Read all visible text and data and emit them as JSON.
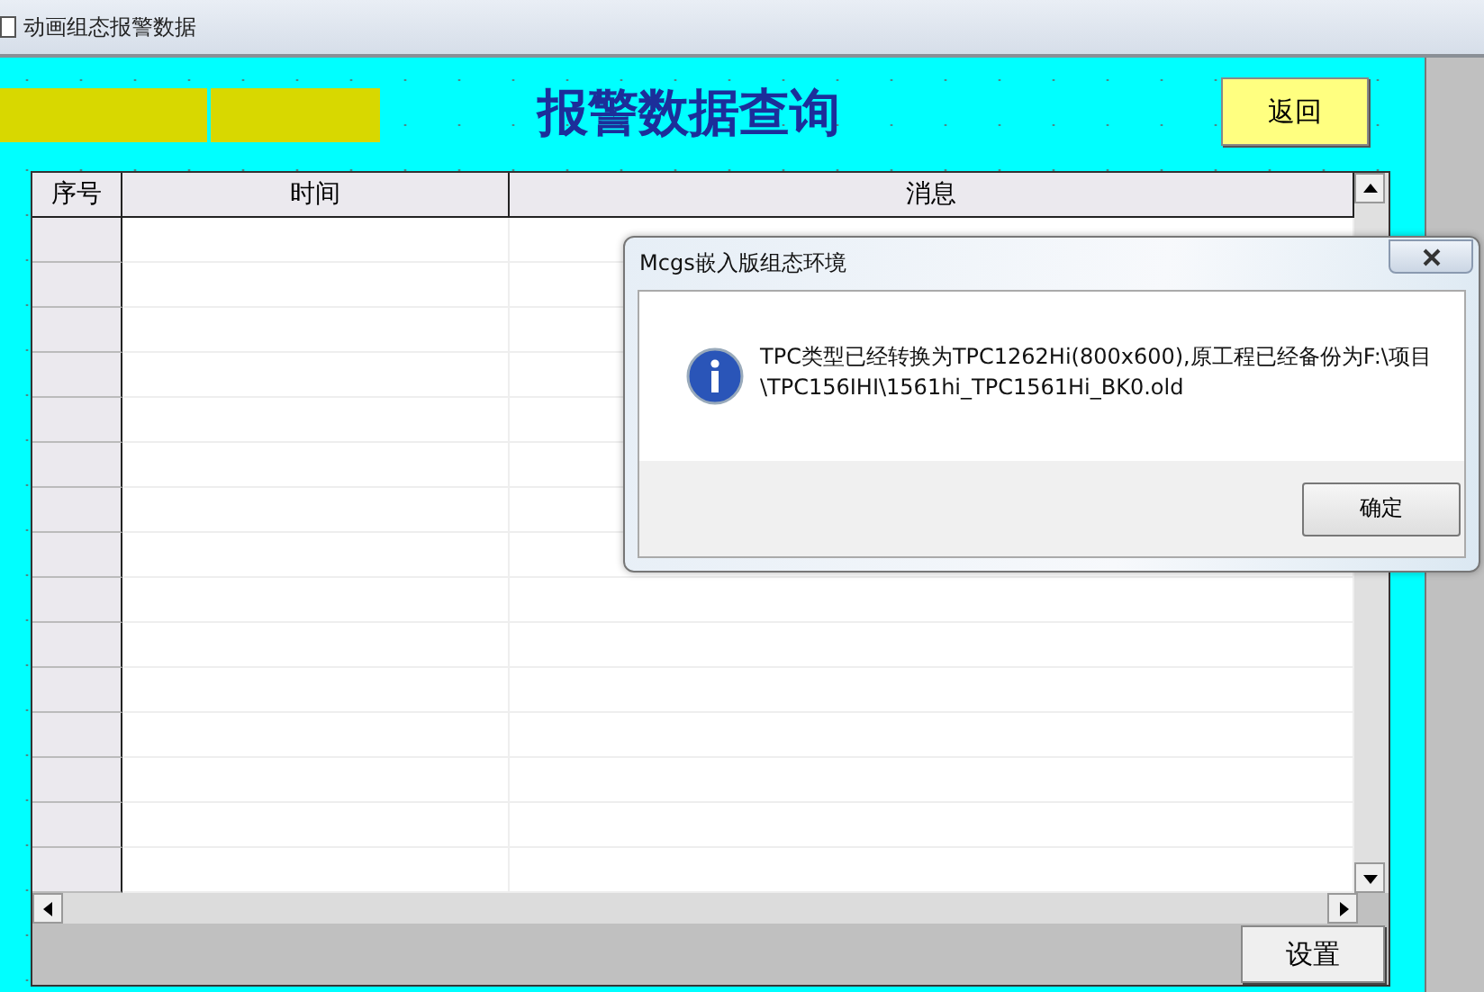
{
  "window": {
    "title": "动画组态报警数据"
  },
  "header": {
    "heading": "报警数据查询",
    "back_button": "返回"
  },
  "table": {
    "columns": [
      "序号",
      "时间",
      "消息"
    ]
  },
  "settings_button": "设置",
  "dialog": {
    "title": "Mcgs嵌入版组态环境",
    "message": "TPC类型已经转换为TPC1262Hi(800x600),原工程已经备份为F:\\项目\n\\TPC156IHI\\1561hi_TPC1561Hi_BK0.old",
    "ok_button": "确定"
  }
}
